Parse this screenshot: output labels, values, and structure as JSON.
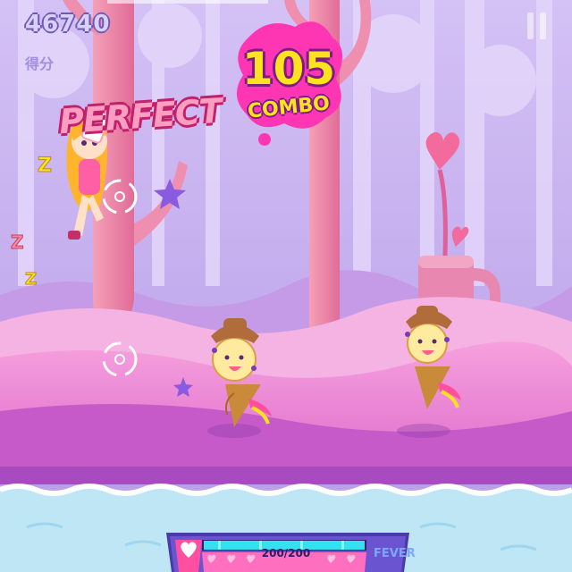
{
  "hud": {
    "score": "46740",
    "score_label": "得分",
    "pause_icon": "pause-icon"
  },
  "combo": {
    "count": "105",
    "label": "COMBO"
  },
  "judgement": "PERFECT",
  "health": {
    "readout": "200/200",
    "current": 200,
    "max": 200,
    "icon": "heart-icon"
  },
  "fever": {
    "label": "FEVER",
    "level": 0.0
  },
  "sleep_letters": [
    "Z",
    "Z",
    "Z"
  ],
  "colors": {
    "sky": "#c9b4ef",
    "ground": "#f08ad6",
    "water": "#bfe6f5",
    "trees": "#f28aa8",
    "score_text": "#d8d0ff",
    "combo_text": "#ffe21f",
    "judgement_text": "#ff9ec0",
    "health_fill": "#36e0ee",
    "hud_bar": "#4b3aa8"
  }
}
